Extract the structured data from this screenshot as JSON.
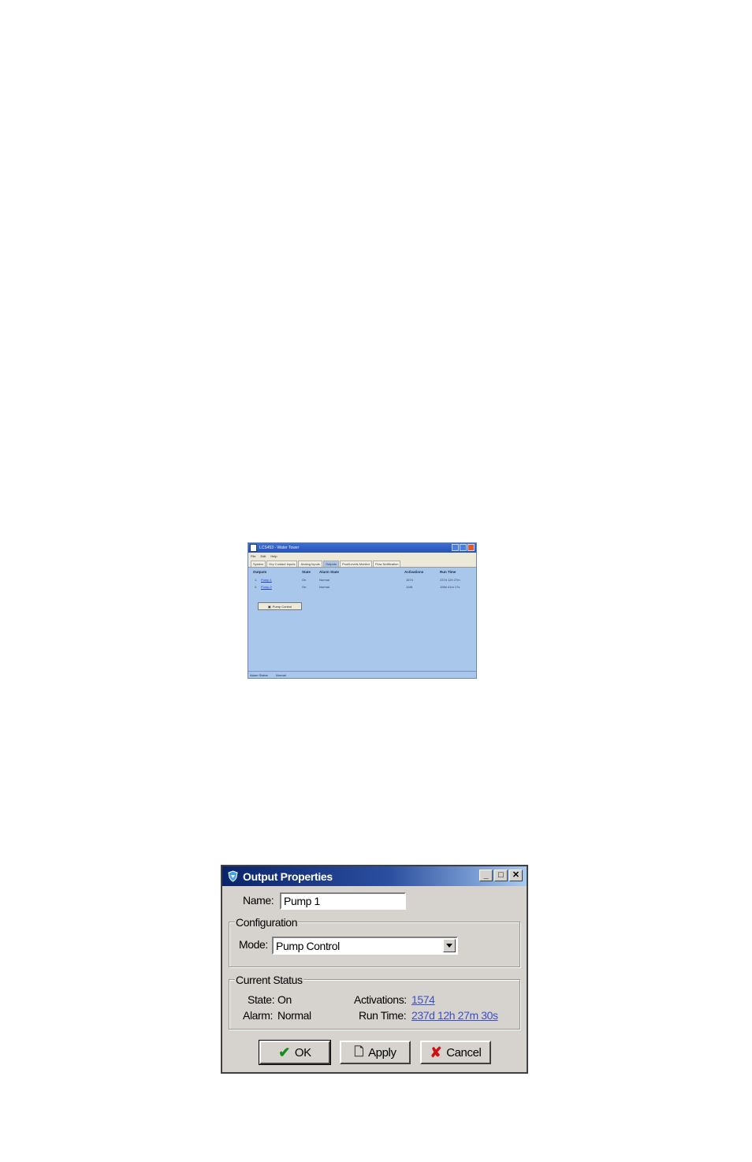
{
  "main_window": {
    "title": "LCS453 - Water Tower",
    "menu": [
      "File",
      "Edit",
      "Help"
    ],
    "tabs": [
      "System",
      "Dry Contact Inputs",
      "Analog Inputs",
      "Outputs",
      "Pool/Levels Monitor",
      "Flow Notification"
    ],
    "active_tab": "Outputs",
    "headers": {
      "outputs": "Outputs",
      "state": "State",
      "alarm": "Alarm State",
      "activations": "Activations",
      "runtime": "Run Time"
    },
    "rows": [
      {
        "index": "1.",
        "name": "Pump 1",
        "state": "On",
        "alarm": "Normal",
        "activations": "1574",
        "runtime": "237d 12h 27m"
      },
      {
        "index": "2.",
        "name": "Pump 2",
        "state": "On",
        "alarm": "Normal",
        "activations": "1281",
        "runtime": "198d 41m 17s"
      }
    ],
    "pump_control_button": "Pump Control",
    "status": {
      "label": "Alarm Status",
      "value": "Normal"
    }
  },
  "dialog": {
    "title": "Output Properties",
    "title_icon": "shield-icon",
    "name_label": "Name:",
    "name_value": "Pump 1",
    "configuration_legend": "Configuration",
    "mode_label": "Mode:",
    "mode_value": "Pump Control",
    "current_status_legend": "Current Status",
    "state_label": "State:",
    "state_value": "On",
    "alarm_label": "Alarm:",
    "alarm_value": "Normal",
    "activations_label": "Activations:",
    "activations_value": "1574",
    "runtime_label": "Run Time:",
    "runtime_value": "237d 12h 27m 30s",
    "buttons": {
      "ok": "OK",
      "apply": "Apply",
      "cancel": "Cancel"
    },
    "colors": {
      "titlebar": "#0a246a",
      "link": "#3a4fc4",
      "ok_check": "#1a8a1a",
      "cancel_x": "#d01010"
    }
  }
}
